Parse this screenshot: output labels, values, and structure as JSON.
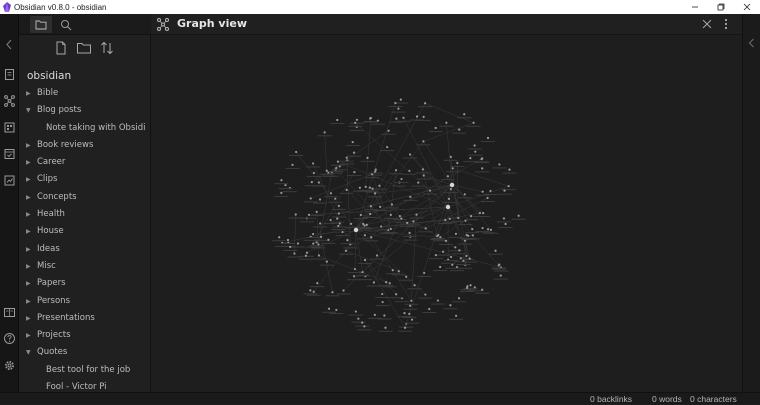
{
  "window": {
    "title": "Obsidian v0.8.0 - obsidian",
    "controls": [
      "minimize",
      "maximize",
      "close"
    ]
  },
  "ribbon": {
    "icons": [
      "collapse-chevron-icon",
      "open-note-icon",
      "graph-view-icon",
      "plugin-icon",
      "calendar-icon",
      "backlinks-icon",
      "vault-icon",
      "help-icon",
      "settings-icon"
    ]
  },
  "sidebar": {
    "tabs": [
      "file-explorer-tab",
      "search-tab"
    ],
    "tools": [
      "new-note",
      "new-folder",
      "sort-order"
    ],
    "vault_name": "obsidian",
    "tree": [
      {
        "label": "Bible",
        "type": "folder",
        "expanded": false
      },
      {
        "label": "Blog posts",
        "type": "folder",
        "expanded": true
      },
      {
        "label": "Note taking with Obsidian",
        "type": "file"
      },
      {
        "label": "Book reviews",
        "type": "folder",
        "expanded": false
      },
      {
        "label": "Career",
        "type": "folder",
        "expanded": false
      },
      {
        "label": "Clips",
        "type": "folder",
        "expanded": false
      },
      {
        "label": "Concepts",
        "type": "folder",
        "expanded": false
      },
      {
        "label": "Health",
        "type": "folder",
        "expanded": false
      },
      {
        "label": "House",
        "type": "folder",
        "expanded": false
      },
      {
        "label": "Ideas",
        "type": "folder",
        "expanded": false
      },
      {
        "label": "Misc",
        "type": "folder",
        "expanded": false
      },
      {
        "label": "Papers",
        "type": "folder",
        "expanded": false
      },
      {
        "label": "Persons",
        "type": "folder",
        "expanded": false
      },
      {
        "label": "Presentations",
        "type": "folder",
        "expanded": false
      },
      {
        "label": "Projects",
        "type": "folder",
        "expanded": false
      },
      {
        "label": "Quotes",
        "type": "folder",
        "expanded": true
      },
      {
        "label": "Best tool for the job",
        "type": "file"
      },
      {
        "label": "Fool - Victor Pi",
        "type": "file"
      }
    ]
  },
  "graph_view": {
    "title": "Graph view",
    "node_color": "#9a9a9a",
    "hub_color": "#d8d8d8",
    "edge_color": "#3a3a3a"
  },
  "statusbar": {
    "backlinks": "0 backlinks",
    "words": "0 words",
    "characters": "0 characters"
  },
  "colors": {
    "background": "#1e1e1e",
    "sidebar": "#202020",
    "text": "#bdbdbd"
  }
}
